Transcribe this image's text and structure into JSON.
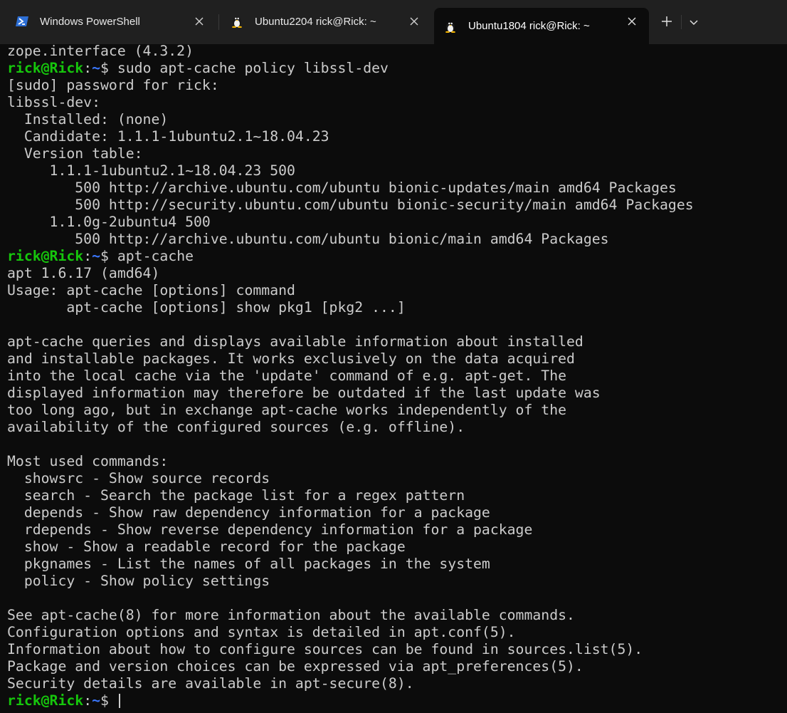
{
  "tabs": [
    {
      "title": "Windows PowerShell",
      "icon": "powershell-icon",
      "active": false
    },
    {
      "title": "Ubuntu2204 rick@Rick: ~",
      "icon": "tux-linux-icon",
      "active": false
    },
    {
      "title": "Ubuntu1804 rick@Rick: ~",
      "icon": "tux-linux-icon",
      "active": true
    }
  ],
  "tabbar": {
    "new_tab_icon": "plus-icon",
    "dropdown_icon": "chevron-down-icon"
  },
  "prompt": {
    "user_host": "rick@Rick",
    "path": "~",
    "symbol": "$"
  },
  "colors": {
    "background": "#0c0c0c",
    "tabbar": "#202020",
    "text": "#cccccc",
    "prompt_user": "#16c60c",
    "prompt_path": "#3b78ff"
  },
  "terminal": {
    "lines": [
      {
        "type": "output",
        "text": "zope.interface (4.3.2)"
      },
      {
        "type": "prompt",
        "text": " sudo apt-cache policy libssl-dev"
      },
      {
        "type": "output",
        "text": "[sudo] password for rick:"
      },
      {
        "type": "output",
        "text": "libssl-dev:"
      },
      {
        "type": "output",
        "text": "  Installed: (none)"
      },
      {
        "type": "output",
        "text": "  Candidate: 1.1.1-1ubuntu2.1~18.04.23"
      },
      {
        "type": "output",
        "text": "  Version table:"
      },
      {
        "type": "output",
        "text": "     1.1.1-1ubuntu2.1~18.04.23 500"
      },
      {
        "type": "output",
        "text": "        500 http://archive.ubuntu.com/ubuntu bionic-updates/main amd64 Packages"
      },
      {
        "type": "output",
        "text": "        500 http://security.ubuntu.com/ubuntu bionic-security/main amd64 Packages"
      },
      {
        "type": "output",
        "text": "     1.1.0g-2ubuntu4 500"
      },
      {
        "type": "output",
        "text": "        500 http://archive.ubuntu.com/ubuntu bionic/main amd64 Packages"
      },
      {
        "type": "prompt",
        "text": " apt-cache"
      },
      {
        "type": "output",
        "text": "apt 1.6.17 (amd64)"
      },
      {
        "type": "output",
        "text": "Usage: apt-cache [options] command"
      },
      {
        "type": "output",
        "text": "       apt-cache [options] show pkg1 [pkg2 ...]"
      },
      {
        "type": "output",
        "text": ""
      },
      {
        "type": "output",
        "text": "apt-cache queries and displays available information about installed"
      },
      {
        "type": "output",
        "text": "and installable packages. It works exclusively on the data acquired"
      },
      {
        "type": "output",
        "text": "into the local cache via the 'update' command of e.g. apt-get. The"
      },
      {
        "type": "output",
        "text": "displayed information may therefore be outdated if the last update was"
      },
      {
        "type": "output",
        "text": "too long ago, but in exchange apt-cache works independently of the"
      },
      {
        "type": "output",
        "text": "availability of the configured sources (e.g. offline)."
      },
      {
        "type": "output",
        "text": ""
      },
      {
        "type": "output",
        "text": "Most used commands:"
      },
      {
        "type": "output",
        "text": "  showsrc - Show source records"
      },
      {
        "type": "output",
        "text": "  search - Search the package list for a regex pattern"
      },
      {
        "type": "output",
        "text": "  depends - Show raw dependency information for a package"
      },
      {
        "type": "output",
        "text": "  rdepends - Show reverse dependency information for a package"
      },
      {
        "type": "output",
        "text": "  show - Show a readable record for the package"
      },
      {
        "type": "output",
        "text": "  pkgnames - List the names of all packages in the system"
      },
      {
        "type": "output",
        "text": "  policy - Show policy settings"
      },
      {
        "type": "output",
        "text": ""
      },
      {
        "type": "output",
        "text": "See apt-cache(8) for more information about the available commands."
      },
      {
        "type": "output",
        "text": "Configuration options and syntax is detailed in apt.conf(5)."
      },
      {
        "type": "output",
        "text": "Information about how to configure sources can be found in sources.list(5)."
      },
      {
        "type": "output",
        "text": "Package and version choices can be expressed via apt_preferences(5)."
      },
      {
        "type": "output",
        "text": "Security details are available in apt-secure(8)."
      },
      {
        "type": "prompt",
        "text": " ",
        "cursor": true
      }
    ]
  }
}
